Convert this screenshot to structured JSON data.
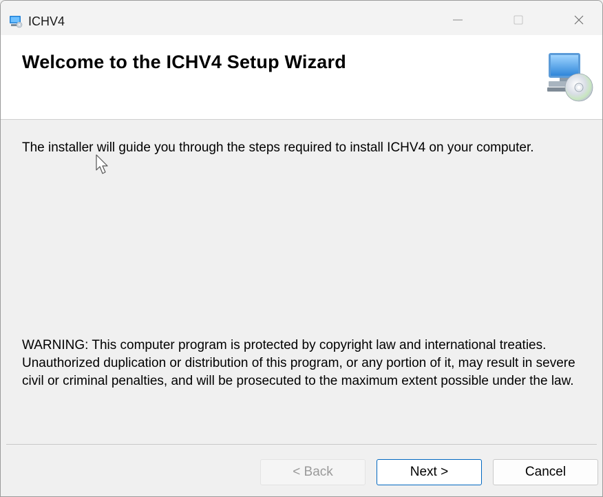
{
  "window": {
    "title": "ICHV4",
    "icon": "installer-computer-icon"
  },
  "titlebar_controls": {
    "minimize_icon": "minimize-icon",
    "maximize_icon": "maximize-icon",
    "close_icon": "close-icon"
  },
  "header": {
    "title": "Welcome to the ICHV4 Setup Wizard",
    "graphic": "computer-with-cd-icon"
  },
  "body": {
    "intro": "The installer will guide you through the steps required to install ICHV4 on your computer.",
    "warning": "WARNING: This computer program is protected by copyright law and international treaties. Unauthorized duplication or distribution of this program, or any portion of it, may result in severe civil or criminal penalties, and will be prosecuted to the maximum extent possible under the law."
  },
  "buttons": {
    "back": "< Back",
    "back_enabled": false,
    "next": "Next >",
    "cancel": "Cancel"
  },
  "colors": {
    "accent": "#0067c0",
    "header_bg": "#ffffff",
    "body_bg": "#f0f0f0"
  }
}
